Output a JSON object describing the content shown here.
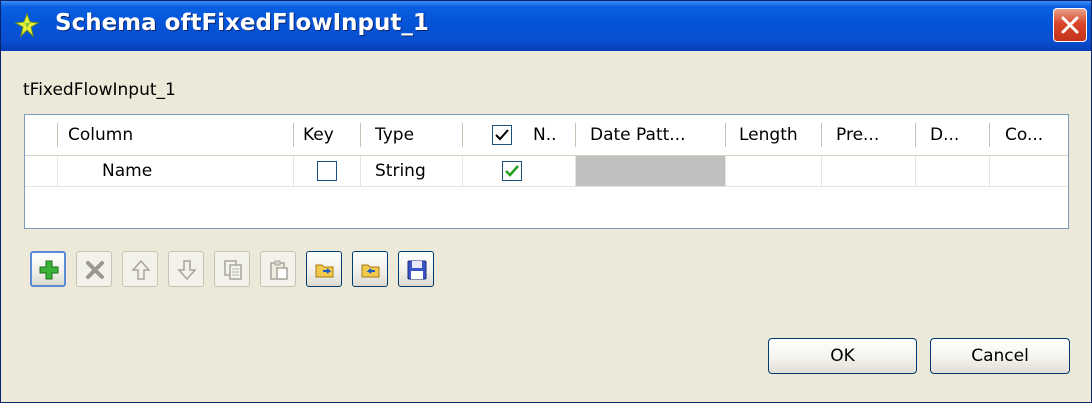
{
  "window": {
    "title": "Schema oftFixedFlowInput_1"
  },
  "dialog": {
    "subtitle": "tFixedFlowInput_1"
  },
  "table": {
    "headers": [
      "Column",
      "Key",
      "Type",
      "N..",
      "Date Patt...",
      "Length",
      "Pre...",
      "D...",
      "Co..."
    ],
    "nullable_header_checked": true,
    "rows": [
      {
        "column": "Name",
        "key": false,
        "type": "String",
        "nullable": true,
        "date_pattern": "",
        "length": "",
        "precision": "",
        "default": "",
        "comment": ""
      }
    ]
  },
  "toolbar": {
    "buttons": [
      {
        "name": "add",
        "enabled": true
      },
      {
        "name": "remove",
        "enabled": false
      },
      {
        "name": "move-up",
        "enabled": false
      },
      {
        "name": "move-down",
        "enabled": false
      },
      {
        "name": "copy",
        "enabled": false
      },
      {
        "name": "paste",
        "enabled": false
      },
      {
        "name": "import",
        "enabled": true
      },
      {
        "name": "export",
        "enabled": true
      },
      {
        "name": "save",
        "enabled": true
      }
    ]
  },
  "actions": {
    "ok_label": "OK",
    "cancel_label": "Cancel"
  }
}
